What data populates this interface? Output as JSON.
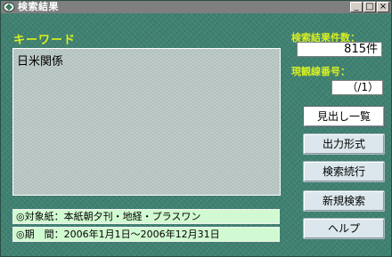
{
  "window": {
    "title": "検索結果"
  },
  "keyword": {
    "label": "キーワード",
    "value": "日米関係"
  },
  "info": {
    "paper": "◎対象紙：本紙朝夕刊・地経・プラスワン",
    "period": "◎期　間：2006年1月1日～2006年12月31日"
  },
  "results": {
    "count_label": "検索結果件数：",
    "count_value": "815件",
    "display_label": "現観線番号：",
    "display_value": "（/1）"
  },
  "buttons": {
    "headline_list": "見出し一覧",
    "output_format": "出力形式",
    "continue_search": "検索続行",
    "new_search": "新規検索",
    "help": "ヘルプ"
  },
  "colors": {
    "background": "#3f8171",
    "label": "#d8f020",
    "info_bg": "#d2fad2"
  }
}
